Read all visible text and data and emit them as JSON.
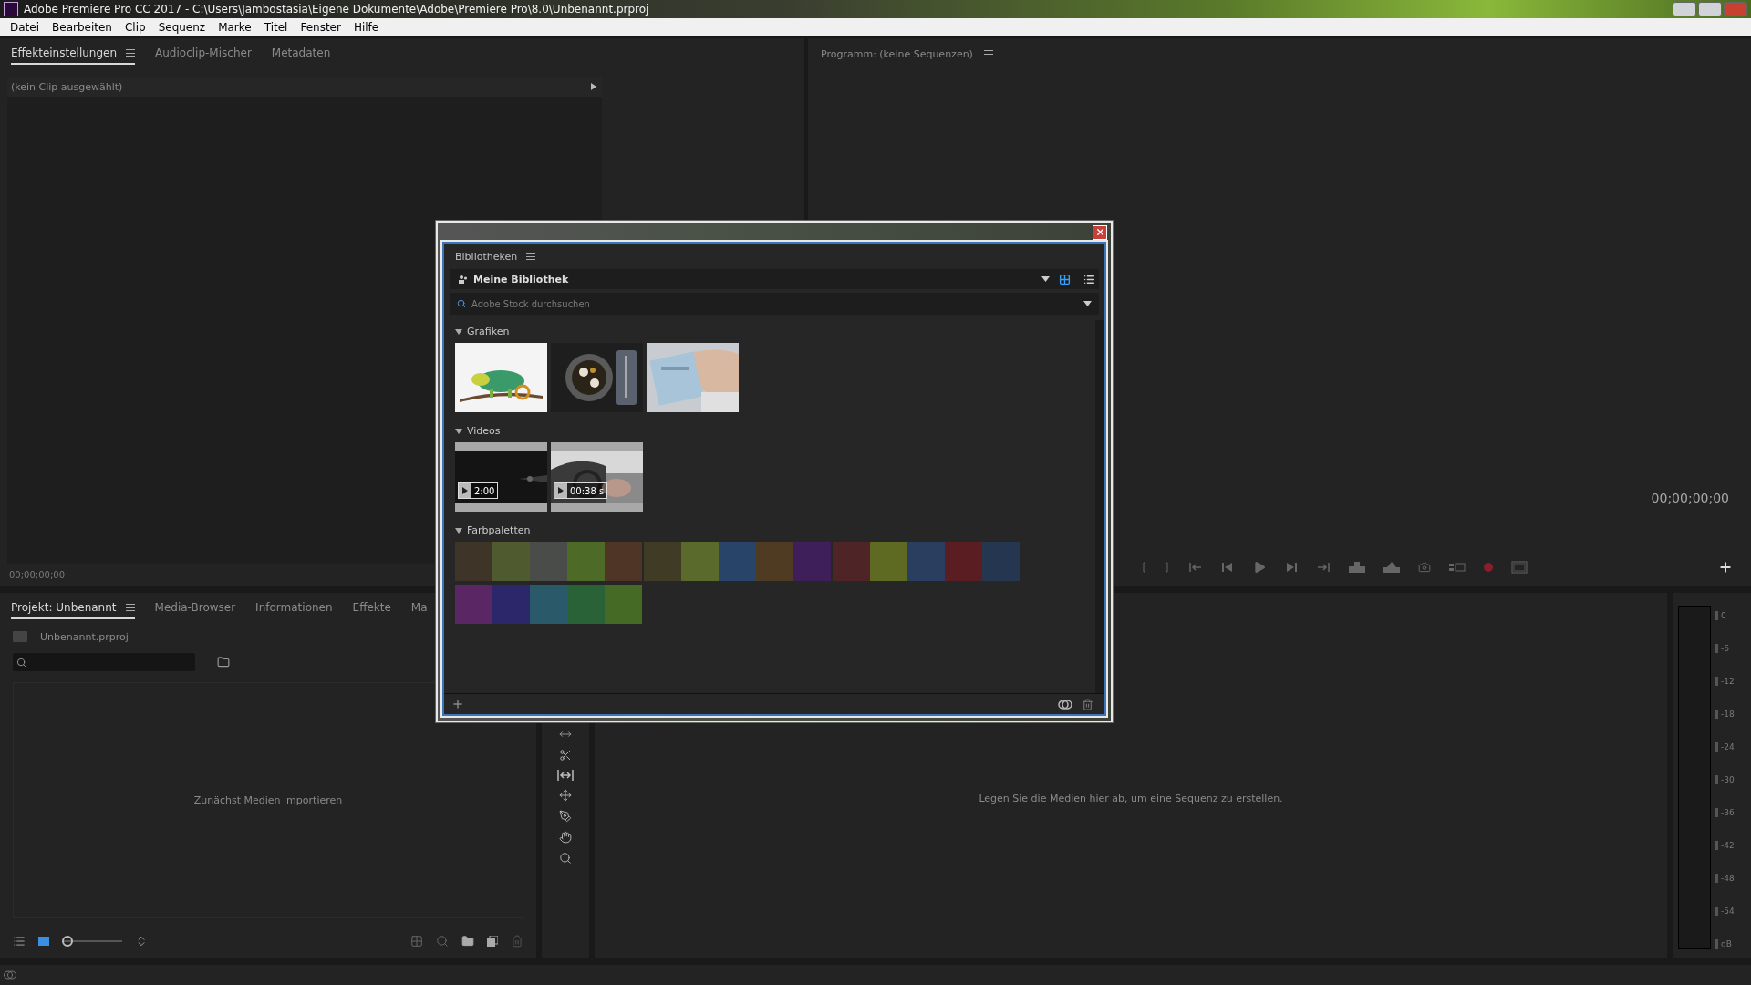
{
  "window": {
    "title": "Adobe Premiere Pro CC 2017 - C:\\Users\\Jambostasia\\Eigene Dokumente\\Adobe\\Premiere Pro\\8.0\\Unbenannt.prproj"
  },
  "menu": [
    "Datei",
    "Bearbeiten",
    "Clip",
    "Sequenz",
    "Marke",
    "Titel",
    "Fenster",
    "Hilfe"
  ],
  "effects_panel": {
    "tabs": [
      {
        "label": "Effekteinstellungen",
        "selected": true
      },
      {
        "label": "Audioclip-Mischer",
        "selected": false
      },
      {
        "label": "Metadaten",
        "selected": false
      }
    ],
    "clip_label": "(kein Clip ausgewählt)",
    "timecode": "00;00;00;00"
  },
  "program_monitor": {
    "title": "Programm: (keine Sequenzen)",
    "timecode": "00;00;00;00"
  },
  "project_panel": {
    "tabs": [
      {
        "label": "Projekt: Unbenannt",
        "selected": true
      },
      {
        "label": "Media-Browser",
        "selected": false
      },
      {
        "label": "Informationen",
        "selected": false
      },
      {
        "label": "Effekte",
        "selected": false
      },
      {
        "label": "Ma",
        "selected": false
      }
    ],
    "file": "Unbenannt.prproj",
    "empty_text": "Zunächst Medien importieren",
    "zoom": {
      "level": 0
    }
  },
  "timeline": {
    "empty_text": "Legen Sie die Medien hier ab, um eine Sequenz zu erstellen."
  },
  "audio_meter": {
    "scale": [
      "0",
      "-6",
      "-12",
      "-18",
      "-24",
      "-30",
      "-36",
      "-42",
      "-48",
      "-54",
      "dB"
    ]
  },
  "libraries_dialog": {
    "title": "Bibliotheken",
    "library": "Meine Bibliothek",
    "search": {
      "placeholder": "Adobe Stock durchsuchen"
    },
    "view_modes": [
      {
        "kind": "grid",
        "selected": true
      },
      {
        "kind": "list",
        "selected": false
      }
    ],
    "sections": [
      {
        "kind": "graphics",
        "title": "Grafiken",
        "expanded": true
      },
      {
        "kind": "videos",
        "title": "Videos",
        "expanded": true,
        "items": [
          {
            "duration": "2:00"
          },
          {
            "duration": "00:38 s"
          }
        ]
      },
      {
        "kind": "palettes",
        "title": "Farbpaletten",
        "expanded": true,
        "palettes": [
          {
            "swatches": [
              {
                "color": "#3e3428"
              },
              {
                "color": "#4f5a2e"
              },
              {
                "color": "#4a4c4a"
              },
              {
                "color": "#4d6a26"
              },
              {
                "color": "#4f3526"
              }
            ]
          },
          {
            "swatches": [
              {
                "color": "#3f3b24"
              },
              {
                "color": "#5a6a2c"
              },
              {
                "color": "#284468"
              },
              {
                "color": "#4f3b22"
              },
              {
                "color": "#3e1f5a"
              }
            ]
          },
          {
            "swatches": [
              {
                "color": "#4f2426"
              },
              {
                "color": "#5e6a22"
              },
              {
                "color": "#2a3f60"
              },
              {
                "color": "#5a1e22"
              },
              {
                "color": "#243650"
              }
            ]
          },
          {
            "swatches": [
              {
                "color": "#5a2664"
              },
              {
                "color": "#2b276a"
              },
              {
                "color": "#2a5a6a"
              },
              {
                "color": "#2a6238"
              },
              {
                "color": "#456a26"
              }
            ]
          }
        ]
      }
    ]
  }
}
